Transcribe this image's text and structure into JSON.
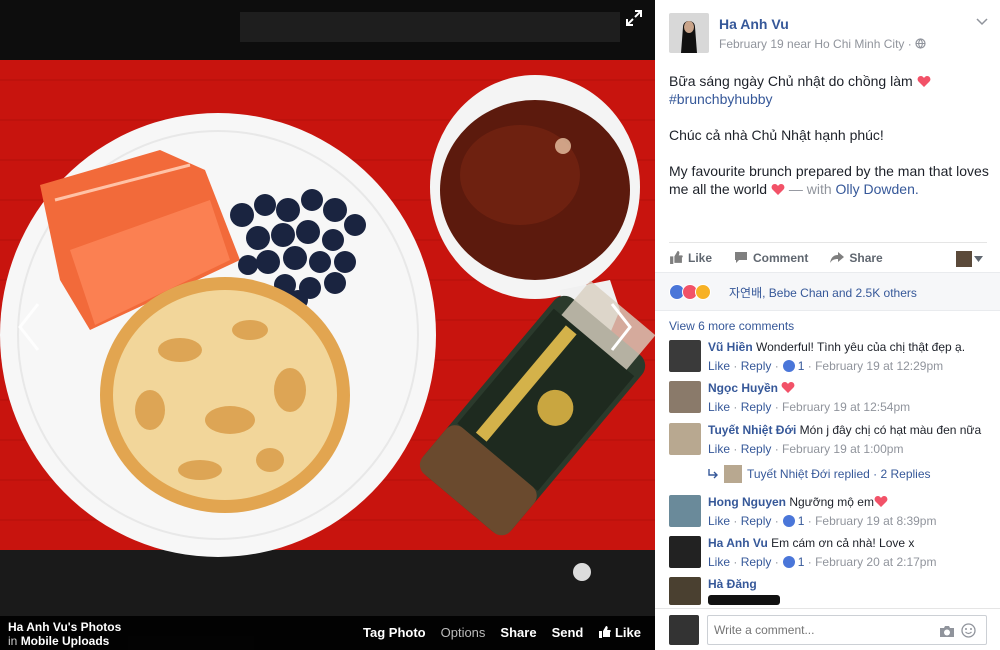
{
  "photo_bar": {
    "album_title": "Ha Anh Vu's Photos",
    "in_label": "in",
    "album_name": "Mobile Uploads",
    "actions": {
      "tag": "Tag Photo",
      "options": "Options",
      "share": "Share",
      "send": "Send",
      "like": "Like"
    }
  },
  "post": {
    "author": "Ha Anh Vu",
    "meta": "February 19 near Ho Chi Minh City ·",
    "line1": "Bữa sáng ngày Chủ nhật do chồng làm",
    "hashtag": "#brunchbyhubby",
    "line2": "Chúc cả nhà Chủ Nhật hạnh phúc!",
    "line3a": "My favourite brunch prepared by the man that loves me all the world",
    "with_text": "— with",
    "tagged": "Olly Dowden."
  },
  "actions": {
    "like": "Like",
    "comment": "Comment",
    "share": "Share"
  },
  "reactions": {
    "text": "자연배, Bebe Chan and 2.5K others"
  },
  "comments_header": {
    "view_more": "View 6 more comments"
  },
  "comments": [
    {
      "name": "Vũ Hiền",
      "text": "Wonderful! Tình yêu của chị thật đẹp ạ.",
      "like": "Like",
      "reply": "Reply",
      "likes": "1",
      "time": "February 19 at 12:29pm"
    },
    {
      "name": "Ngọc Huyền",
      "text": "",
      "like": "Like",
      "reply": "Reply",
      "likes": "",
      "time": "February 19 at 12:54pm"
    },
    {
      "name": "Tuyết Nhiệt Đới",
      "text": "Món j đây chị có hạt màu đen nữa",
      "like": "Like",
      "reply": "Reply",
      "likes": "",
      "time": "February 19 at 1:00pm"
    },
    {
      "name": "Hong Nguyen",
      "text": "Ngưỡng mộ em",
      "like": "Like",
      "reply": "Reply",
      "likes": "1",
      "time": "February 19 at 8:39pm"
    },
    {
      "name": "Ha Anh Vu",
      "text": "Em cám ơn cả nhà! Love x",
      "like": "Like",
      "reply": "Reply",
      "likes": "1",
      "time": "February 20 at 2:17pm"
    },
    {
      "name": "Hà Đăng",
      "text": "",
      "like": "",
      "reply": "",
      "likes": "",
      "time": ""
    }
  ],
  "replies_link": {
    "text": "Tuyết Nhiệt Đới replied · 2 Replies"
  },
  "write_comment": {
    "placeholder": "Write a comment..."
  },
  "colors": {
    "link": "#365899",
    "meta": "#90949c",
    "heart": "#f25268",
    "like_blue": "#4a76d9"
  },
  "icons": [
    "expand-icon",
    "chevron-left-icon",
    "chevron-right-icon",
    "globe-icon",
    "like-icon",
    "comment-icon",
    "share-icon",
    "camera-icon",
    "smile-icon",
    "heart-icon"
  ]
}
